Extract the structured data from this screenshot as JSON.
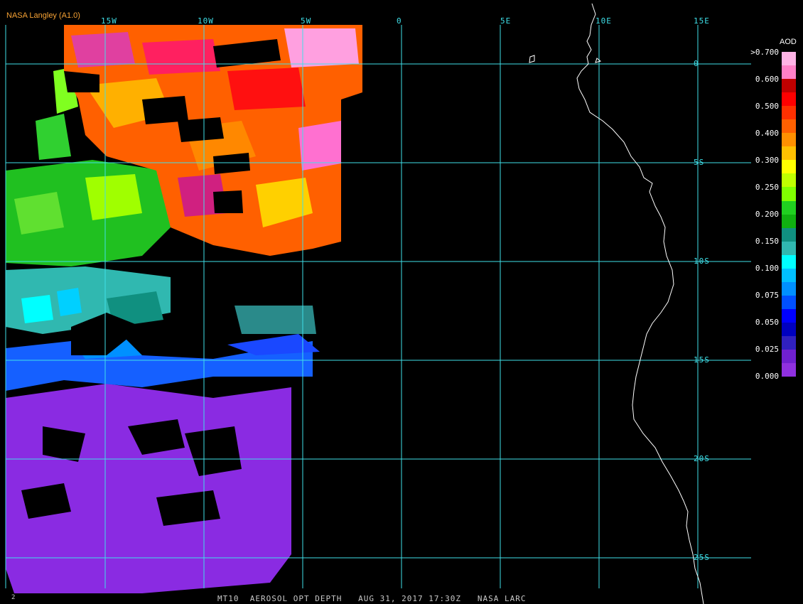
{
  "credit": "NASA Langley (A1.0)",
  "lon_labels": [
    "15W",
    "10W",
    "5W",
    "0",
    "5E",
    "10E",
    "15E"
  ],
  "lat_labels": [
    "0",
    "5S",
    "10S",
    "15S",
    "20S",
    "25S"
  ],
  "legend": {
    "title": "AOD",
    "ticks": [
      ">0.700",
      "0.600",
      "0.500",
      "0.400",
      "0.300",
      "0.250",
      "0.200",
      "0.150",
      "0.100",
      "0.075",
      "0.050",
      "0.025",
      "0.000"
    ],
    "colors": [
      "#ffb3e6",
      "#ff80c8",
      "#c00000",
      "#ff0000",
      "#ff3000",
      "#ff6000",
      "#ff9000",
      "#ffc000",
      "#ffff00",
      "#c0ff00",
      "#80ff00",
      "#20d020",
      "#10b010",
      "#109080",
      "#30b8b0",
      "#00ffff",
      "#00c0ff",
      "#0090ff",
      "#0050ff",
      "#0000ff",
      "#0000c0",
      "#3020c0",
      "#7020d0",
      "#9030e0"
    ]
  },
  "caption": "MT10  AEROSOL OPT DEPTH   AUG 31, 2017 17:30Z   NASA LARC",
  "corner_mark": "2",
  "colors": {
    "grid": "#3fdfe8",
    "coast": "#ffffff",
    "credit": "#f7a234"
  }
}
